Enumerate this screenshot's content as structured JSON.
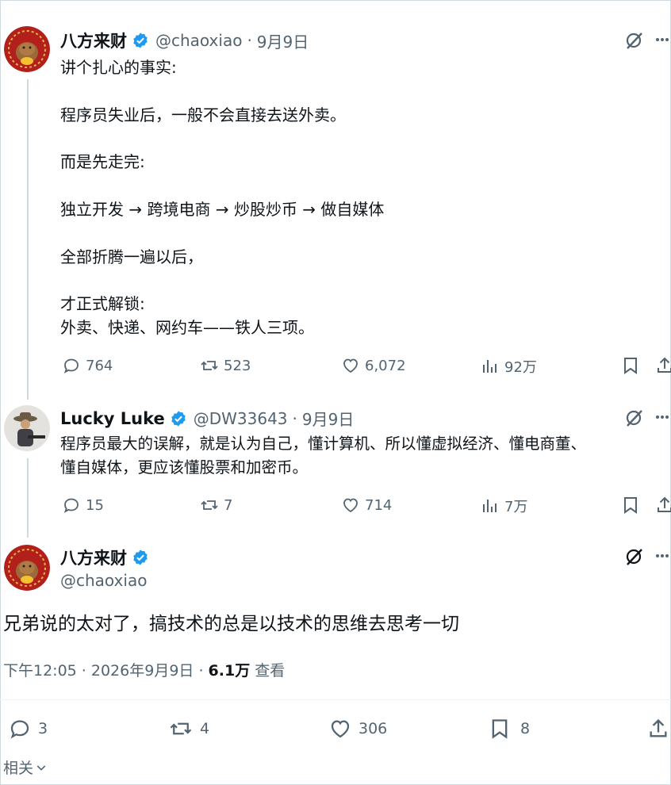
{
  "tweet1": {
    "name": "八方来财",
    "handle": "@chaoxiao",
    "dot": "·",
    "date": "9月9日",
    "lines": [
      "讲个扎心的事实:",
      "",
      "程序员失业后，一般不会直接去送外卖。",
      "",
      "而是先走完:",
      "",
      "独立开发 → 跨境电商 → 炒股炒币 → 做自媒体",
      "",
      "全部折腾一遍以后，",
      "",
      "才正式解锁:",
      "外卖、快递、网约车——铁人三项。"
    ],
    "replies": "764",
    "retweets": "523",
    "likes": "6,072",
    "views": "92万"
  },
  "tweet2": {
    "name": "Lucky Luke",
    "handle": "@DW33643",
    "dot": "·",
    "date": "9月9日",
    "lines": [
      "程序员最大的误解，就是认为自己，懂计算机、所以懂虚拟经济、懂电商董、",
      "懂自媒体，更应该懂股票和加密币。"
    ],
    "replies": "15",
    "retweets": "7",
    "likes": "714",
    "views": "7万"
  },
  "main": {
    "name": "八方来财",
    "handle": "@chaoxiao",
    "text": "兄弟说的太对了，搞技术的总是以技术的思维去思考一切",
    "time": "下午12:05 · 2026年9月9日 · ",
    "views_count": "6.1万",
    "views_label": " 查看",
    "replies": "3",
    "retweets": "4",
    "likes": "306",
    "bookmarks": "8",
    "related": "相关"
  },
  "colors": {
    "verified": "#1d9bf0",
    "muted": "#536471",
    "line": "#cfd9de"
  },
  "icons": [
    "reply-icon",
    "retweet-icon",
    "like-icon",
    "views-icon",
    "bookmark-icon",
    "share-icon",
    "grok-icon",
    "more-icon",
    "verified-icon",
    "chevron-down-icon"
  ]
}
